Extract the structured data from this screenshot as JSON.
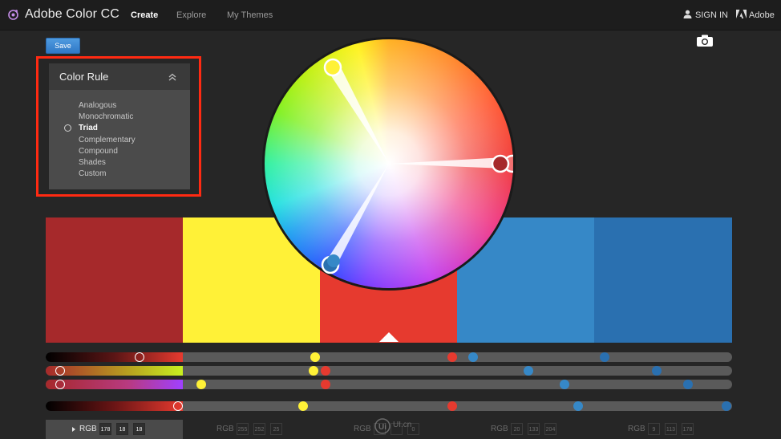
{
  "app": {
    "title": "Adobe Color CC",
    "nav": [
      "Create",
      "Explore",
      "My Themes"
    ],
    "active_nav": "Create",
    "sign_in": "SIGN IN",
    "adobe_link": "Adobe"
  },
  "toolbar": {
    "save_label": "Save"
  },
  "color_rule": {
    "title": "Color Rule",
    "options": [
      "Analogous",
      "Monochromatic",
      "Triad",
      "Complementary",
      "Compound",
      "Shades",
      "Custom"
    ],
    "selected": "Triad"
  },
  "swatches": [
    {
      "color": "#a6292b",
      "rgb": [
        "178",
        "18",
        "18"
      ]
    },
    {
      "color": "#fff137",
      "rgb": [
        "255",
        "252",
        "25"
      ]
    },
    {
      "color": "#e63a2f",
      "rgb": [
        "",
        "",
        "0"
      ]
    },
    {
      "color": "#3688c7",
      "rgb": [
        "20",
        "133",
        "204"
      ]
    },
    {
      "color": "#2a70b0",
      "rgb": [
        "9",
        "113",
        "178"
      ]
    }
  ],
  "active_swatch": 2,
  "rgb_label": "RGB",
  "watermark": "UI.cn",
  "colors": {
    "accent_blue": "#3384d6",
    "highlight_red": "#ff2a12"
  },
  "icons": [
    "color-logo-icon",
    "user-icon",
    "adobe-logo-icon",
    "camera-icon",
    "chevron-up-icon",
    "radio-icon",
    "play-arrow-icon"
  ]
}
